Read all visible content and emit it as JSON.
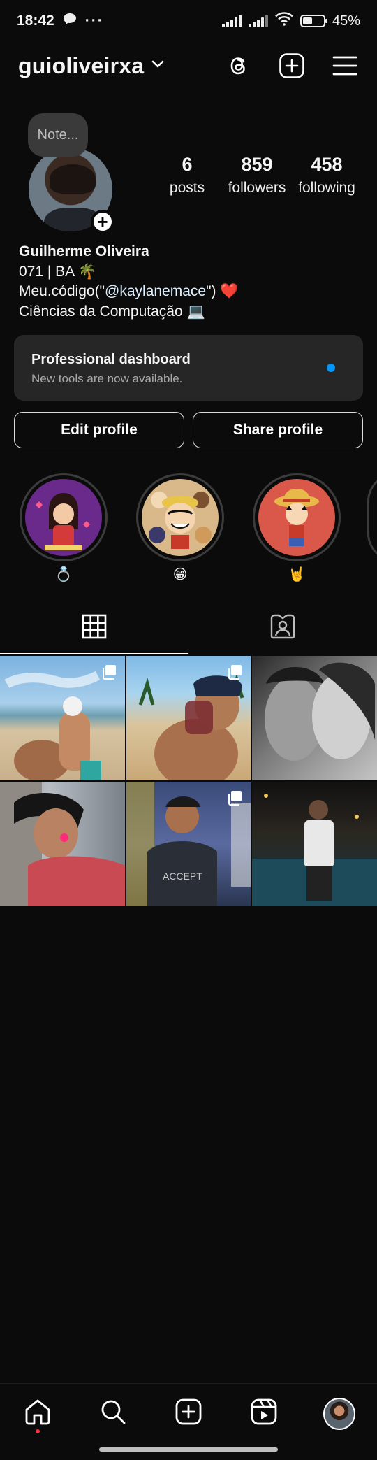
{
  "status_bar": {
    "time": "18:42",
    "battery": "45%",
    "battery_level": 0.45
  },
  "header": {
    "username": "guioliveirxa"
  },
  "profile": {
    "note_placeholder": "Note...",
    "stats": [
      {
        "value": "6",
        "label": "posts"
      },
      {
        "value": "859",
        "label": "followers"
      },
      {
        "value": "458",
        "label": "following"
      }
    ],
    "bio": {
      "name": "Guilherme Oliveira",
      "line1": "071 | BA 🌴",
      "line2_prefix": "Meu.código(\"",
      "line2_mention": "@kaylanemace",
      "line2_suffix": "\") ",
      "line2_heart": "❤️",
      "line3": "Ciências da Computação 💻"
    }
  },
  "dashboard": {
    "title": "Professional dashboard",
    "subtitle": "New tools are now available."
  },
  "buttons": {
    "edit_profile": "Edit profile",
    "share_profile": "Share profile"
  },
  "highlights": [
    {
      "label": "💍",
      "color": "#6a2a8c"
    },
    {
      "label": "😁",
      "color": "#d9b98a"
    },
    {
      "label": "🤘",
      "color": "#d9584a"
    }
  ],
  "posts": [
    {
      "kind": "beach-couple",
      "multi": true
    },
    {
      "kind": "drink-selfie",
      "multi": true
    },
    {
      "kind": "bw-couple",
      "multi": false
    },
    {
      "kind": "side-portrait",
      "multi": false
    },
    {
      "kind": "mirror-selfie",
      "multi": true
    },
    {
      "kind": "night-pool",
      "multi": false
    }
  ],
  "colors": {
    "background": "#0b0b0b",
    "accent": "#0095f6",
    "notification": "#ff3040"
  }
}
